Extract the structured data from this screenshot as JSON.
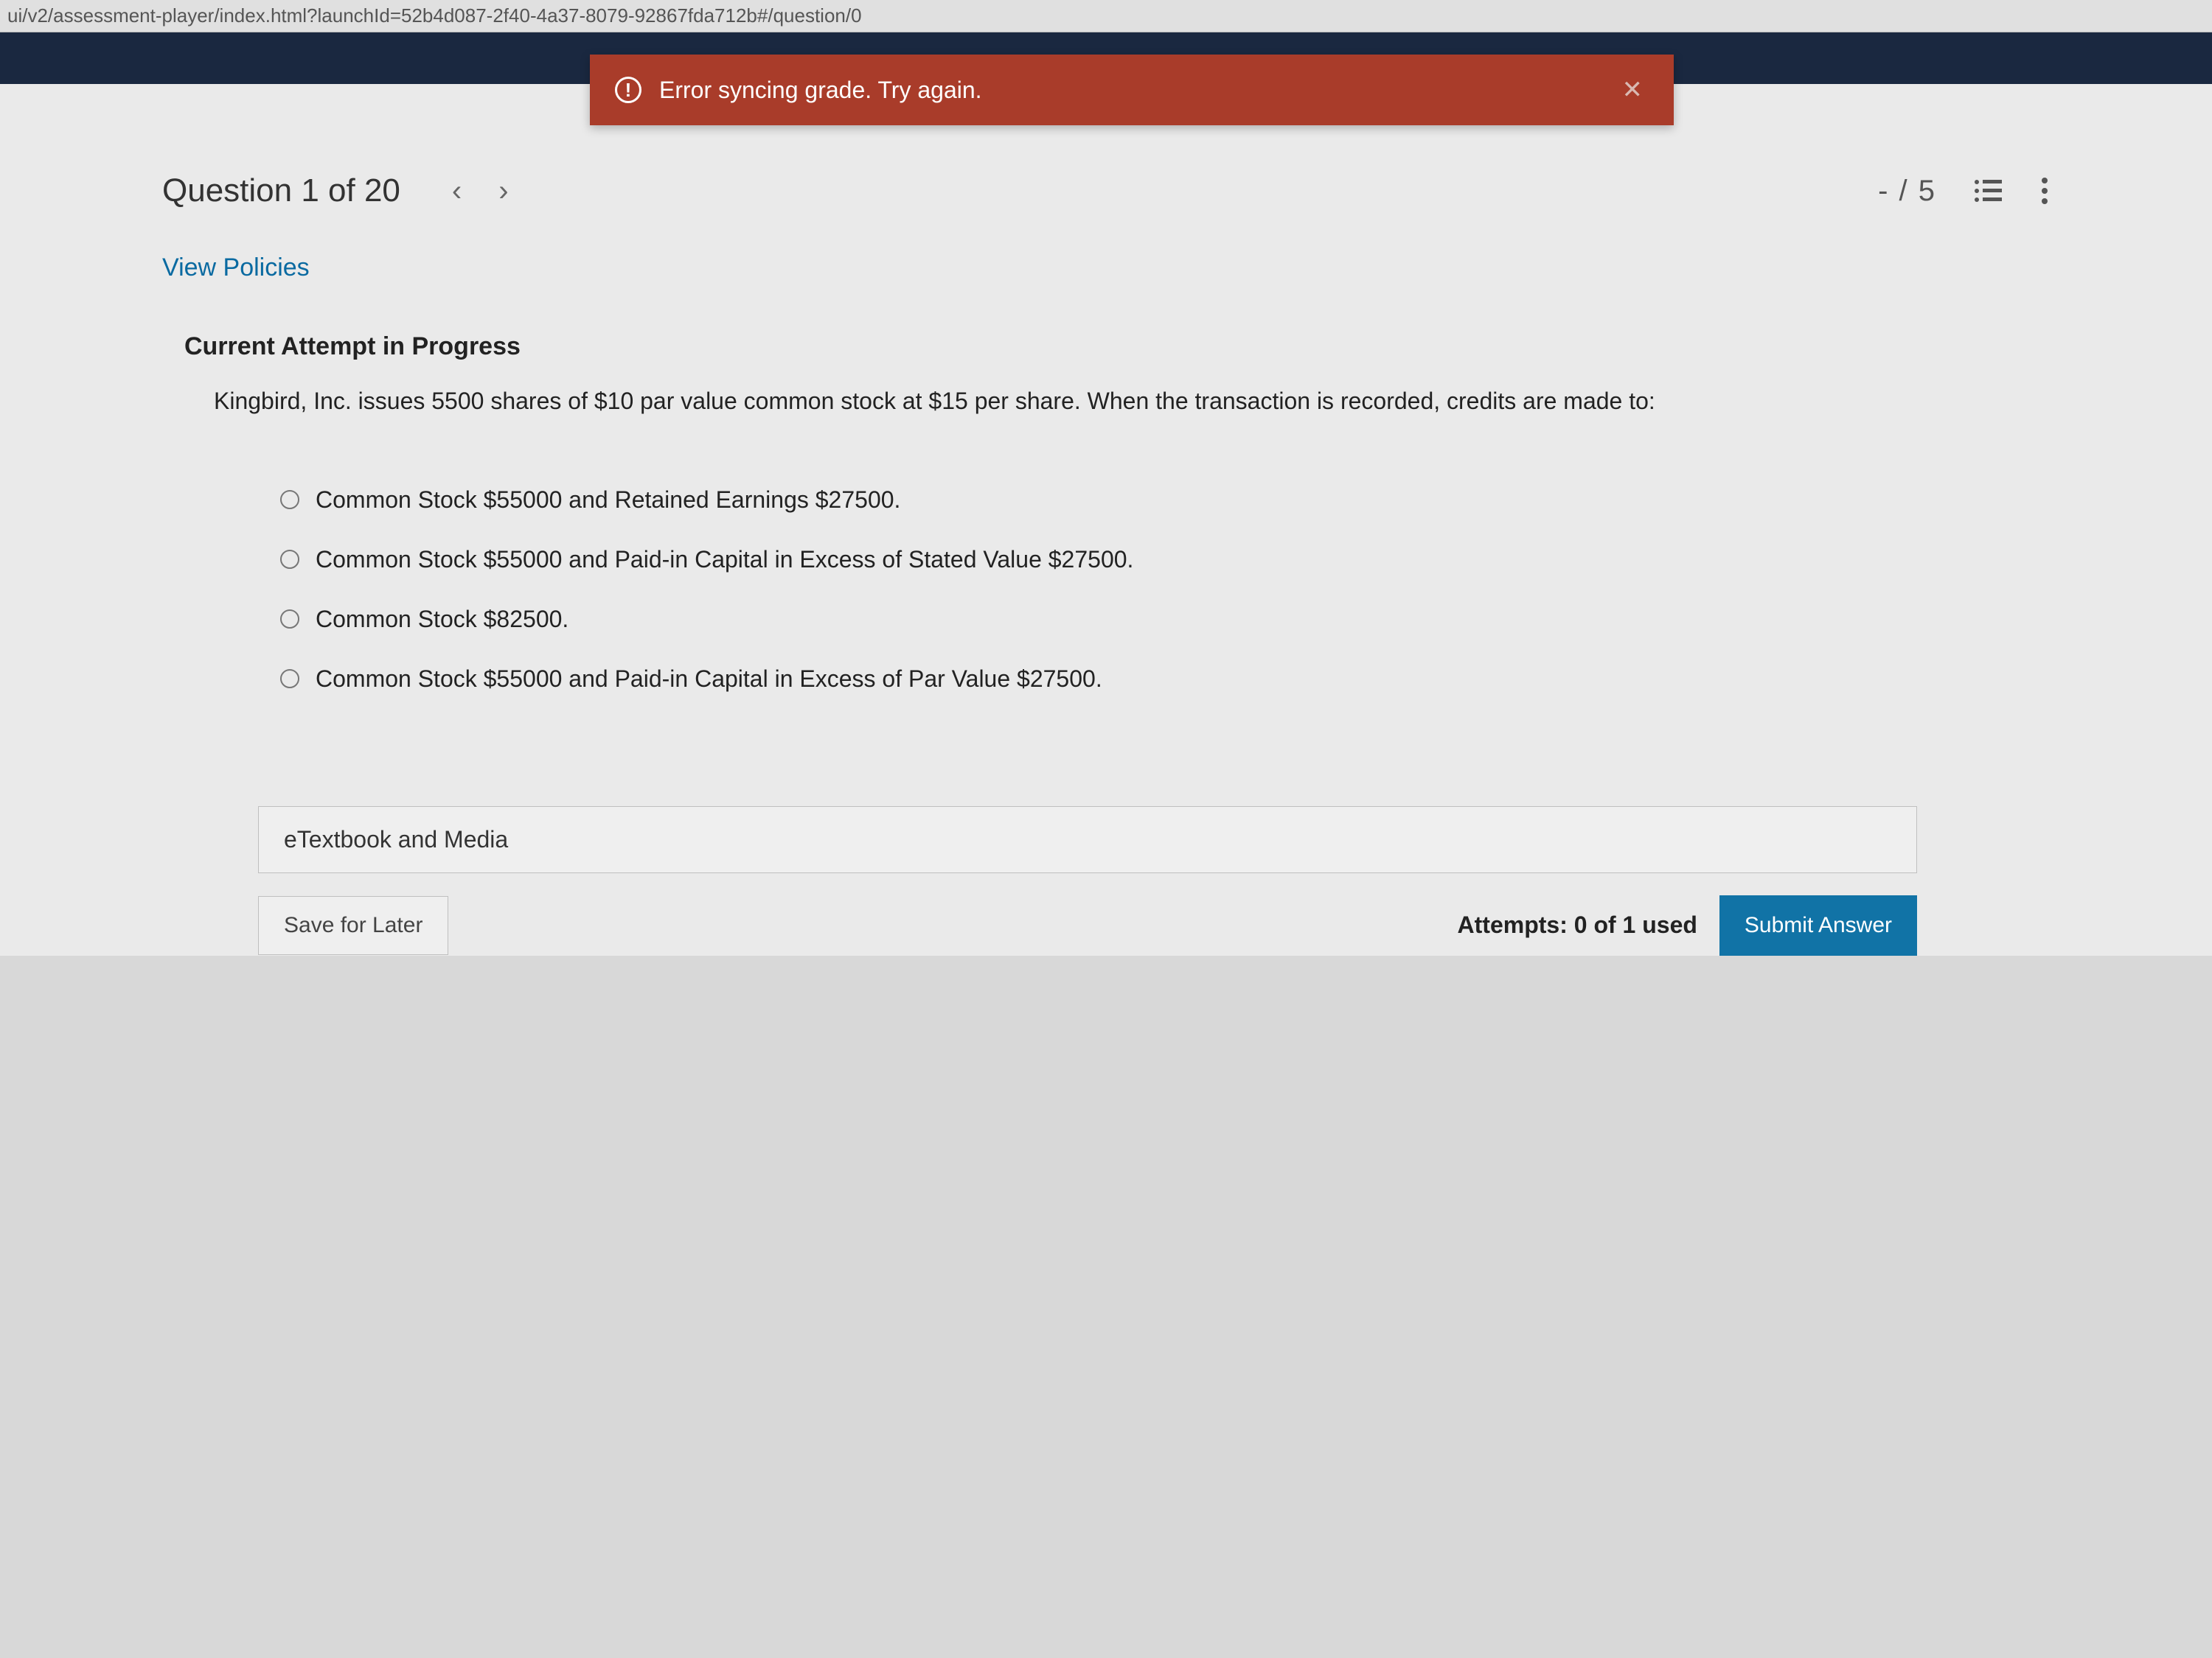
{
  "url_bar": "ui/v2/assessment-player/index.html?launchId=52b4d087-2f40-4a37-8079-92867fda712b#/question/0",
  "error": {
    "message": "Error syncing grade. Try again."
  },
  "header": {
    "question_label": "Question 1 of 20",
    "score": "- / 5"
  },
  "links": {
    "policies": "View Policies"
  },
  "attempt_heading": "Current Attempt in Progress",
  "question": {
    "text": "Kingbird, Inc. issues 5500 shares of $10 par value common stock at $15 per share. When the transaction is recorded, credits are made to:",
    "options": [
      "Common Stock $55000 and Retained Earnings $27500.",
      "Common Stock $55000 and Paid-in Capital in Excess of Stated Value $27500.",
      "Common Stock $82500.",
      "Common Stock $55000 and Paid-in Capital in Excess of Par Value $27500."
    ]
  },
  "etext_label": "eTextbook and Media",
  "footer": {
    "save_label": "Save for Later",
    "attempts_text": "Attempts: 0 of 1 used",
    "submit_label": "Submit Answer"
  }
}
